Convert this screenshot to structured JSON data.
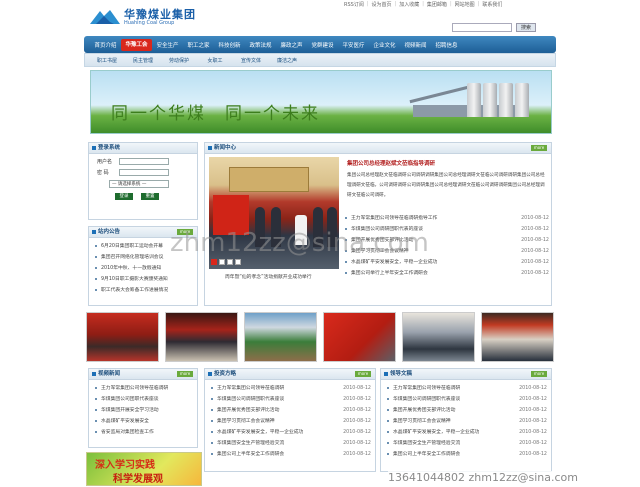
{
  "header": {
    "logo_cn": "华豫煤业集团",
    "logo_en": "Huahing Coal Group",
    "toplinks": [
      "RSS订阅",
      "设为首页",
      "加入收藏",
      "集团邮箱",
      "网站地图",
      "联系我们"
    ],
    "search_button": "搜索"
  },
  "nav": {
    "items": [
      "首页介绍",
      "华豫工会",
      "安全生产",
      "职工之家",
      "科技创新",
      "政策法规",
      "廉政之声",
      "党群建设",
      "平安医疗",
      "企业文化",
      "视频新闻",
      "招聘信息"
    ],
    "active_index": 1
  },
  "subnav": {
    "items": [
      "职工书屋",
      "民主管理",
      "劳动保护",
      "女职工",
      "宣传文体",
      "廉洁之声"
    ]
  },
  "banner": {
    "slogan": "同一个华煤　同一个未来"
  },
  "login": {
    "title": "登录系统",
    "username_label": "用户名",
    "password_label": "密 码",
    "select_value": "— 请选择系统 —",
    "login_button": "登录",
    "reset_button": "重置"
  },
  "notices": {
    "title": "站内公告",
    "more": "more",
    "items": [
      "6月20日集团职工运动会开幕",
      "集团召开网络化管理培训会议",
      "2010年中秋、十一放假通知",
      "9月10日职工摄影大赛颁奖通知",
      "职工代表大会筹备工作进展情况"
    ]
  },
  "news_center": {
    "title": "新闻中心",
    "more": "more",
    "headline": "集团公司总经理赵斌文莅临指导调研",
    "summary": "集团公司总经理赵文莅临调研公司调研调研集团公司总经理调研文莅临公司调研调研集团公司总经理调研文莅临，公司调研调研公司调研集团公司总经理调研文莅临公司调研调研集团公司总经理调研文莅临公司调研。",
    "caption": "周年暨“仙的孝念”活动捐献开业成功举行",
    "items": [
      {
        "title": "王力军常集团公司领导莅临调研指导工作",
        "date": "2010-08-12"
      },
      {
        "title": "华煤集团公司调研团职代表的座谈",
        "date": "2010-08-12"
      },
      {
        "title": "集团开展优秀团支部评比活动",
        "date": "2010-08-12"
      },
      {
        "title": "集团学习贯彻工会会议精神",
        "date": "2010-08-12"
      },
      {
        "title": "水晶煤矿平安发展安全，平稳一企业成功",
        "date": "2010-08-12"
      },
      {
        "title": "集团公司举行上半年安全工作调研会",
        "date": "2010-08-12"
      }
    ]
  },
  "video_news": {
    "title": "视频新闻",
    "more": "more",
    "items": [
      "王力军常集团公司领导莅临调研",
      "华煤集团公司团职代表座谈",
      "华煤集团开展安全学习活动",
      "水晶煤矿平安发展安全",
      "省安监局对集团检查工作"
    ]
  },
  "investment": {
    "title": "投资方略",
    "more": "more",
    "items": [
      {
        "title": "王力军常集团公司领导莅临调研",
        "date": "2010-08-12"
      },
      {
        "title": "华煤集团公司调研团职代表座谈",
        "date": "2010-08-12"
      },
      {
        "title": "集团开展优秀团支部评比活动",
        "date": "2010-08-12"
      },
      {
        "title": "集团学习贯彻工会会议精神",
        "date": "2010-08-12"
      },
      {
        "title": "水晶煤矿平安发展安全，平稳一企业成功",
        "date": "2010-08-12"
      },
      {
        "title": "华煤集团安全生产管理经验交流",
        "date": "2010-08-12"
      },
      {
        "title": "集团公司上半年安全工作调研会",
        "date": "2010-08-12"
      }
    ]
  },
  "leader_speech": {
    "title": "领导文稿",
    "more": "more",
    "items": [
      {
        "title": "王力军常集团公司领导莅临调研",
        "date": "2010-08-12"
      },
      {
        "title": "华煤集团公司调研团职代表座谈",
        "date": "2010-08-12"
      },
      {
        "title": "集团开展优秀团支部评比活动",
        "date": "2010-08-12"
      },
      {
        "title": "集团学习贯彻工会会议精神",
        "date": "2010-08-12"
      },
      {
        "title": "水晶煤矿平安发展安全，平稳一企业成功",
        "date": "2010-08-12"
      },
      {
        "title": "华煤集团安全生产管理经验交流",
        "date": "2010-08-12"
      },
      {
        "title": "集团公司上半年安全工作调研会",
        "date": "2010-08-12"
      }
    ]
  },
  "promo": {
    "line1": "深入学习实践",
    "line2": "科学发展观"
  },
  "watermarks": {
    "center": "zhm12zz@sina.com",
    "bottom": "13641044802  zhm12zz@sina.com"
  }
}
